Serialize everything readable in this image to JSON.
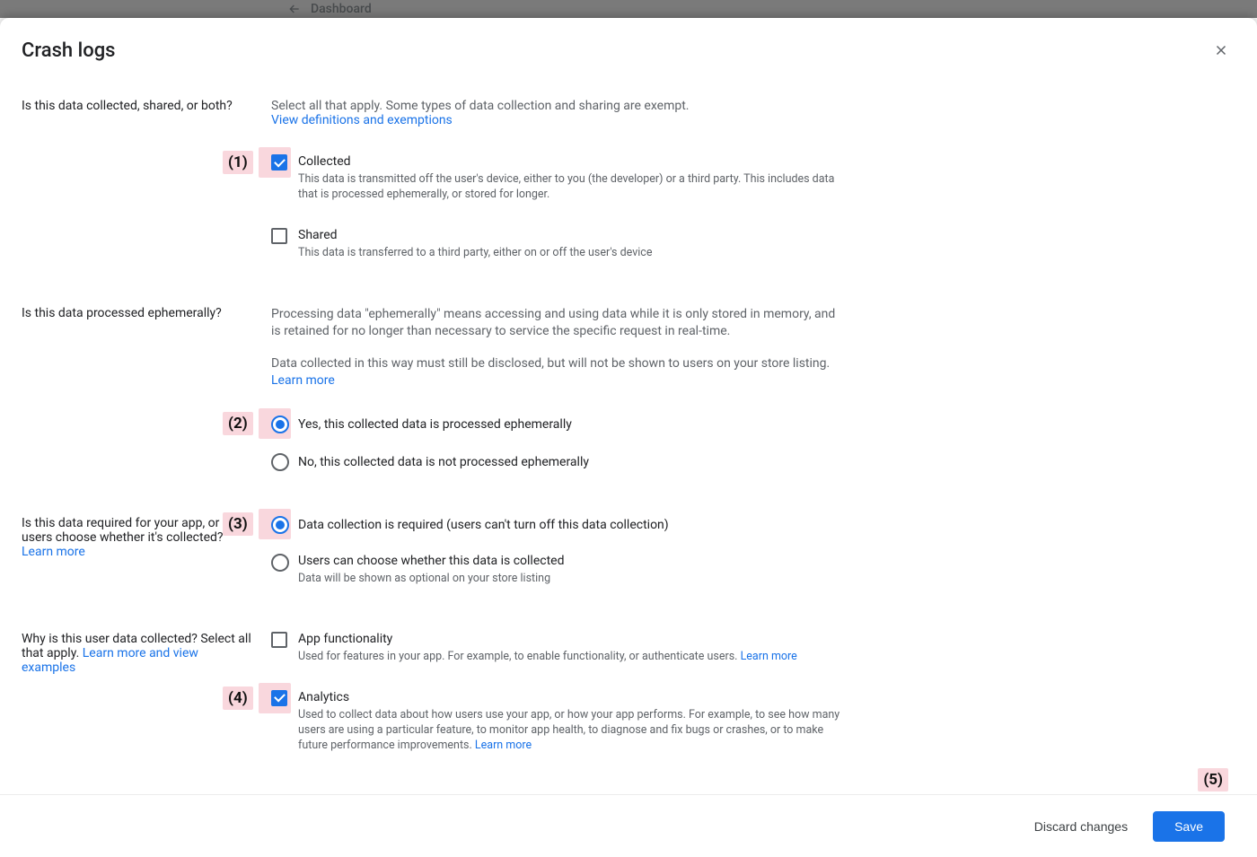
{
  "background": {
    "dashboard_label": "Dashboard"
  },
  "dialog": {
    "title": "Crash logs",
    "q1": {
      "question": "Is this data collected, shared, or both?",
      "intro": "Select all that apply. Some types of data collection and sharing are exempt.",
      "link": "View definitions and exemptions",
      "collected": {
        "label": "Collected",
        "sub": "This data is transmitted off the user's device, either to you (the developer) or a third party. This includes data that is processed ephemerally, or stored for longer."
      },
      "shared": {
        "label": "Shared",
        "sub": "This data is transferred to a third party, either on or off the user's device"
      }
    },
    "q2": {
      "question": "Is this data processed ephemerally?",
      "para1": "Processing data \"ephemerally\" means accessing and using data while it is only stored in memory, and is retained for no longer than necessary to service the specific request in real-time.",
      "para2_a": "Data collected in this way must still be disclosed, but will not be shown to users on your store listing. ",
      "learn_more": "Learn more",
      "yes": "Yes, this collected data is processed ephemerally",
      "no": "No, this collected data is not processed ephemerally"
    },
    "q3": {
      "question": "Is this data required for your app, or can users choose whether it's collected?",
      "learn_more": "Learn more",
      "required": "Data collection is required (users can't turn off this data collection)",
      "optional": "Users can choose whether this data is collected",
      "optional_sub": "Data will be shown as optional on your store listing"
    },
    "q4": {
      "question_a": "Why is this user data collected? Select all that apply. ",
      "link": "Learn more and view examples",
      "app_func": {
        "label": "App functionality",
        "sub_a": "Used for features in your app. For example, to enable functionality, or authenticate users. ",
        "learn_more": "Learn more"
      },
      "analytics": {
        "label": "Analytics",
        "sub_a": "Used to collect data about how users use your app, or how your app performs. For example, to see how many users are using a particular feature, to monitor app health, to diagnose and fix bugs or crashes, or to make future performance improvements. ",
        "learn_more": "Learn more"
      }
    },
    "footer": {
      "discard": "Discard changes",
      "save": "Save"
    },
    "annotations": {
      "a1": "(1)",
      "a2": "(2)",
      "a3": "(3)",
      "a4": "(4)",
      "a5": "(5)"
    }
  }
}
